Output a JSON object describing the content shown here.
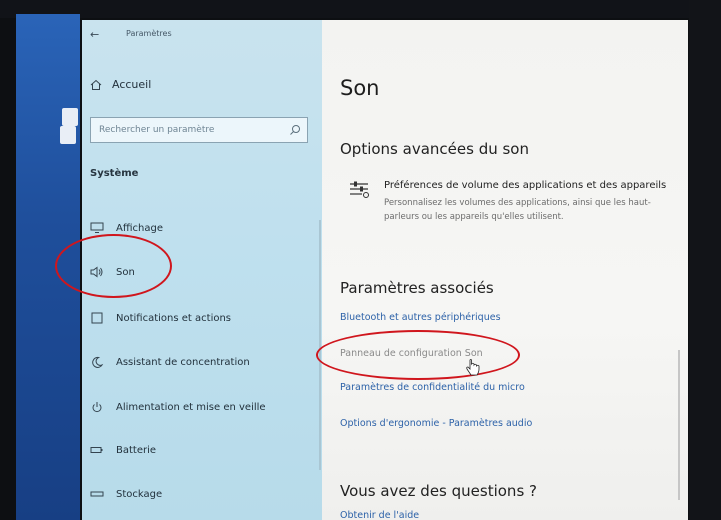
{
  "window": {
    "title": "Paramètres"
  },
  "sidebar": {
    "home_label": "Accueil",
    "search_placeholder": "Rechercher un paramètre",
    "section": "Système",
    "items": [
      {
        "label": "Affichage",
        "icon": "monitor-icon"
      },
      {
        "label": "Son",
        "icon": "speaker-icon"
      },
      {
        "label": "Notifications et actions",
        "icon": "notification-icon"
      },
      {
        "label": "Assistant de concentration",
        "icon": "moon-icon"
      },
      {
        "label": "Alimentation et mise en veille",
        "icon": "power-icon"
      },
      {
        "label": "Batterie",
        "icon": "battery-icon"
      },
      {
        "label": "Stockage",
        "icon": "storage-icon"
      }
    ]
  },
  "main": {
    "title": "Son",
    "advanced": {
      "heading": "Options avancées du son",
      "pref_title": "Préférences de volume des applications et des appareils",
      "pref_desc": "Personnalisez les volumes des applications, ainsi que les haut-parleurs ou les appareils qu'elles utilisent.",
      "icon": "sliders-icon"
    },
    "associated": {
      "heading": "Paramètres associés",
      "links": [
        "Bluetooth et autres périphériques",
        "Panneau de configuration Son",
        "Paramètres de confidentialité du micro",
        "Options d'ergonomie - Paramètres audio"
      ]
    },
    "questions": {
      "heading": "Vous avez des questions ?",
      "help": "Obtenir de l'aide"
    }
  },
  "colors": {
    "annotation": "#d0161d",
    "link": "#2d62a8",
    "sidebar_bg": "#c0e0ee"
  }
}
